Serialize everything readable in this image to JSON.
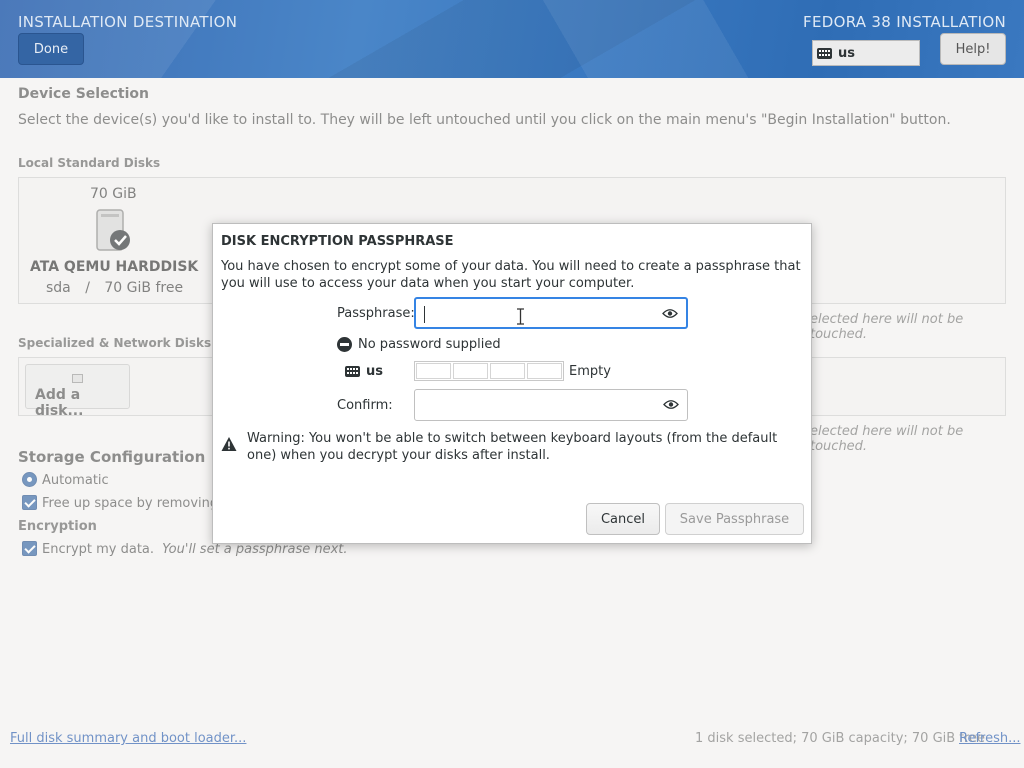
{
  "header": {
    "title": "INSTALLATION DESTINATION",
    "product": "FEDORA 38 INSTALLATION",
    "done_label": "Done",
    "keyboard_layout": "us",
    "help_label": "Help!"
  },
  "device_selection": {
    "title": "Device Selection",
    "description": "Select the device(s) you'd like to install to.  They will be left untouched until you click on the main menu's \"Begin Installation\" button.",
    "local_disks_label": "Local Standard Disks",
    "disk": {
      "size": "70 GiB",
      "name": "ATA QEMU HARDDISK",
      "device": "sda",
      "separator": "/",
      "free": "70 GiB free",
      "selected": true
    },
    "local_note": "elected here will not be touched.",
    "specialized_label": "Specialized & Network Disks",
    "add_disk_label": "Add a disk...",
    "network_note": "elected here will not be touched."
  },
  "storage_configuration": {
    "title": "Storage Configuration",
    "automatic_label": "Automatic",
    "free_space_label": "Free up space by removing or",
    "encryption_title": "Encryption",
    "encrypt_label": "Encrypt my data.",
    "encrypt_note": "You'll set a passphrase next."
  },
  "footer": {
    "summary_link": "Full disk summary and boot loader...",
    "summary_text": "1 disk selected; 70 GiB capacity; 70 GiB free",
    "refresh_link": "Refresh..."
  },
  "dialog": {
    "title": "DISK ENCRYPTION PASSPHRASE",
    "message": "You have chosen to encrypt some of your data. You will need to create a passphrase that you will use to access your data when you start your computer.",
    "passphrase_label": "Passphrase:",
    "passphrase_value": "",
    "strength_text": "No password supplied",
    "keyboard_layout": "us",
    "strength_level_text": "Empty",
    "strength_level": 0,
    "confirm_label": "Confirm:",
    "confirm_value": "",
    "warning": "Warning: You won't be able to switch between keyboard layouts (from the default one) when you decrypt your disks after install.",
    "cancel_label": "Cancel",
    "save_label": "Save Passphrase"
  },
  "colors": {
    "accent": "#3465a4",
    "focus": "#3584e4",
    "link": "#2a5db0"
  }
}
